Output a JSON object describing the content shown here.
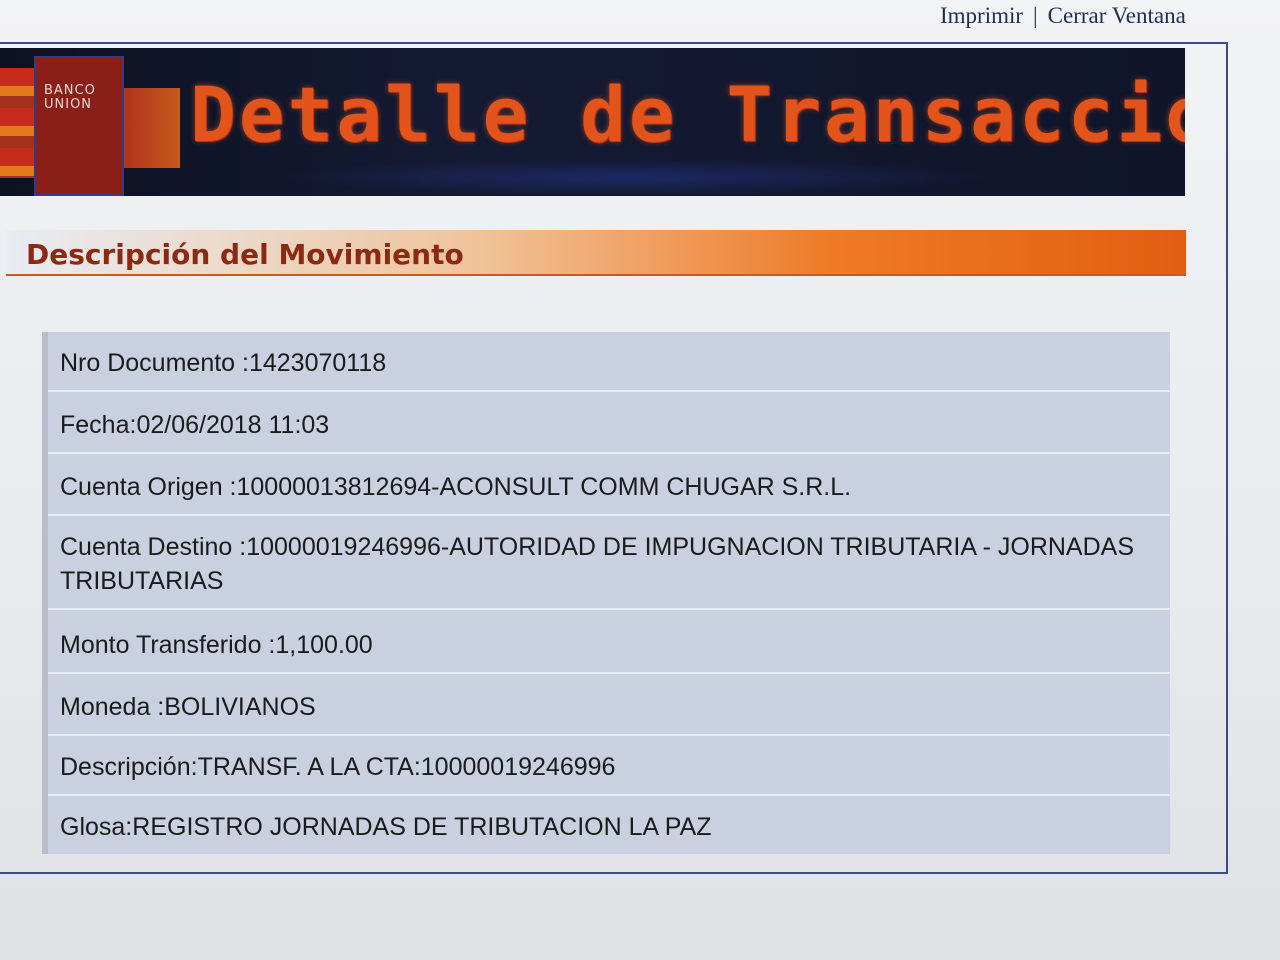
{
  "top_links": {
    "print": "Imprimir",
    "separator": "|",
    "close": "Cerrar Ventana"
  },
  "banner": {
    "logo_text": "BANCO UNION",
    "title": "Detalle de Transacciones"
  },
  "section": {
    "title": "Descripción del Movimiento"
  },
  "details": [
    {
      "label": "Nro Documento :",
      "value": "1423070118"
    },
    {
      "label": "Fecha:",
      "value": "02/06/2018 11:03"
    },
    {
      "label": "Cuenta Origen :",
      "value": "10000013812694-ACONSULT COMM CHUGAR S.R.L."
    },
    {
      "label": "Cuenta Destino :",
      "value": "10000019246996-AUTORIDAD DE IMPUGNACION TRIBUTARIA - JORNADAS TRIBUTARIAS"
    },
    {
      "label": "Monto Transferido :",
      "value": "1,100.00"
    },
    {
      "label": "Moneda :",
      "value": "BOLIVIANOS"
    },
    {
      "label": "Descripción:",
      "value": "TRANSF. A LA CTA:10000019246996"
    },
    {
      "label": "Glosa:",
      "value": "REGISTRO JORNADAS DE TRIBUTACION LA PAZ"
    }
  ],
  "colors": {
    "banner_bg": "#10152a",
    "banner_title": "#e2541c",
    "section_accent": "#e25e12",
    "section_title": "#8a2a12",
    "detail_bg": "#c9d0e0",
    "link": "#1f2d54"
  }
}
